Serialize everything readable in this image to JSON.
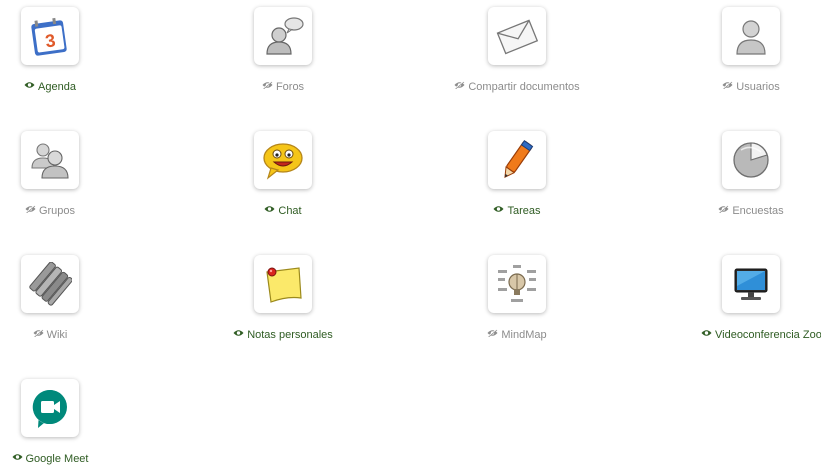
{
  "colors": {
    "visible_label": "#2f5c23",
    "hidden_label": "#8c8c8c"
  },
  "tools": [
    {
      "id": "agenda",
      "label": "Agenda",
      "visible": true,
      "icon": "calendar-icon"
    },
    {
      "id": "foros",
      "label": "Foros",
      "visible": false,
      "icon": "forum-icon"
    },
    {
      "id": "compartir",
      "label": "Compartir documentos",
      "visible": false,
      "icon": "envelope-icon"
    },
    {
      "id": "usuarios",
      "label": "Usuarios",
      "visible": false,
      "icon": "user-icon"
    },
    {
      "id": "grupos",
      "label": "Grupos",
      "visible": false,
      "icon": "group-icon"
    },
    {
      "id": "chat",
      "label": "Chat",
      "visible": true,
      "icon": "chat-smiley-icon"
    },
    {
      "id": "tareas",
      "label": "Tareas",
      "visible": true,
      "icon": "pencil-icon"
    },
    {
      "id": "encuestas",
      "label": "Encuestas",
      "visible": false,
      "icon": "pie-chart-icon"
    },
    {
      "id": "wiki",
      "label": "Wiki",
      "visible": false,
      "icon": "wiki-icon"
    },
    {
      "id": "notas",
      "label": "Notas personales",
      "visible": true,
      "icon": "sticky-note-icon"
    },
    {
      "id": "mindmap",
      "label": "MindMap",
      "visible": false,
      "icon": "mindmap-icon"
    },
    {
      "id": "zoom",
      "label": "Videoconferencia Zoom",
      "visible": true,
      "icon": "monitor-icon"
    },
    {
      "id": "meet",
      "label": "Google Meet",
      "visible": true,
      "icon": "google-meet-icon"
    }
  ]
}
